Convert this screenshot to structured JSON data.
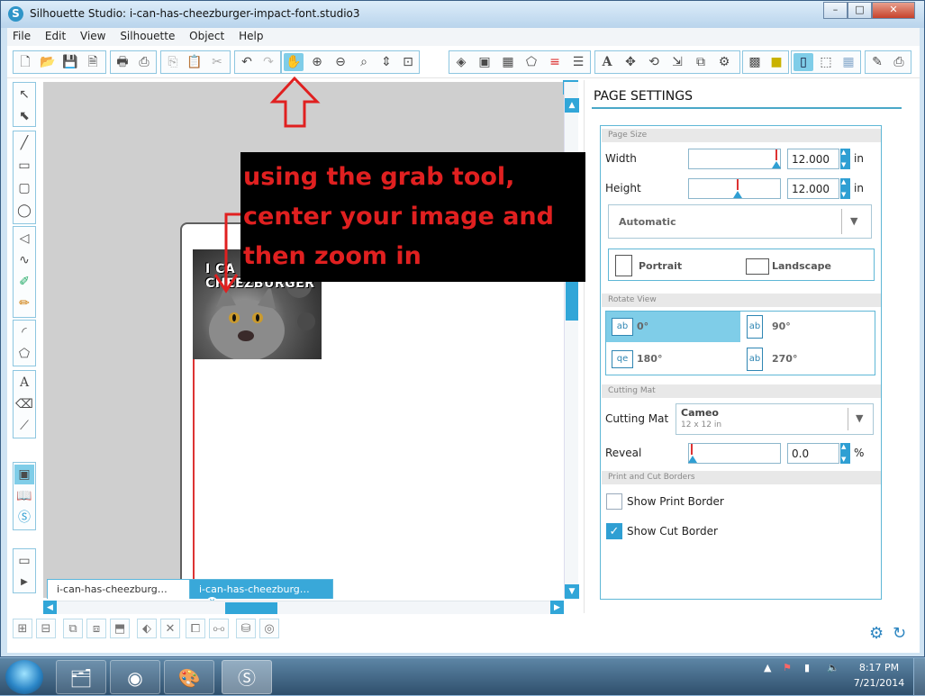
{
  "window": {
    "title": "Silhouette Studio: i-can-has-cheezburger-impact-font.studio3",
    "app_icon": "S",
    "minimize": "–",
    "maximize": "□",
    "close": "✕"
  },
  "menu": [
    "File",
    "Edit",
    "View",
    "Silhouette",
    "Object",
    "Help"
  ],
  "toolbar": {
    "icons": [
      "new-file-icon",
      "open-icon",
      "save-icon",
      "save-library-icon",
      "print-icon",
      "print-cut-icon",
      "copy-icon",
      "paste-icon",
      "cut-icon",
      "undo-icon",
      "redo-icon",
      "grab-hand-icon",
      "zoom-in-icon",
      "zoom-out-icon",
      "zoom-select-icon",
      "drag-zoom-icon",
      "fit-page-icon",
      "fill-color-icon",
      "line-color-icon",
      "fill-pattern-icon",
      "line-style-icon",
      "line-color-bars-icon",
      "line-width-icon",
      "text-style-icon",
      "transform-icon",
      "rotate-icon",
      "scale-icon",
      "replicate-icon",
      "offset-icon",
      "library-icon",
      "trace-icon",
      "page-settings-icon",
      "cut-settings-icon",
      "registration-icon",
      "grid-icon",
      "send-icon"
    ]
  },
  "tabs": [
    {
      "label": "i-can-has-cheezburg…",
      "active": false
    },
    {
      "label": "i-can-has-cheezburg…",
      "active": true
    }
  ],
  "image_caption": "I CA CHEEZBURGER",
  "annotation": {
    "text": "using the grab tool, center your image and then zoom in"
  },
  "panel": {
    "title": "PAGE SETTINGS",
    "page_size_section": "Page Size",
    "width_label": "Width",
    "width_value": "12.000",
    "height_label": "Height",
    "height_value": "12.000",
    "unit": "in",
    "size_preset": "Automatic",
    "portrait": "Portrait",
    "landscape": "Landscape",
    "rotate_section": "Rotate View",
    "rotations": [
      {
        "icon": "ab",
        "label": "0°",
        "active": true
      },
      {
        "icon": "ab",
        "label": "90°",
        "active": false
      },
      {
        "icon": "qe",
        "label": "180°",
        "active": false
      },
      {
        "icon": "ab",
        "label": "270°",
        "active": false
      }
    ],
    "mat_section": "Cutting Mat",
    "mat_label": "Cutting Mat",
    "mat_value": "Cameo",
    "mat_sub": "12 x 12 in",
    "reveal_label": "Reveal",
    "reveal_value": "0.0",
    "reveal_unit": "%",
    "borders_section": "Print and Cut Borders",
    "show_print_border": "Show Print Border",
    "show_print_border_checked": false,
    "show_cut_border": "Show Cut Border",
    "show_cut_border_checked": true
  },
  "taskbar": {
    "time": "8:17 PM",
    "date": "7/21/2014"
  }
}
